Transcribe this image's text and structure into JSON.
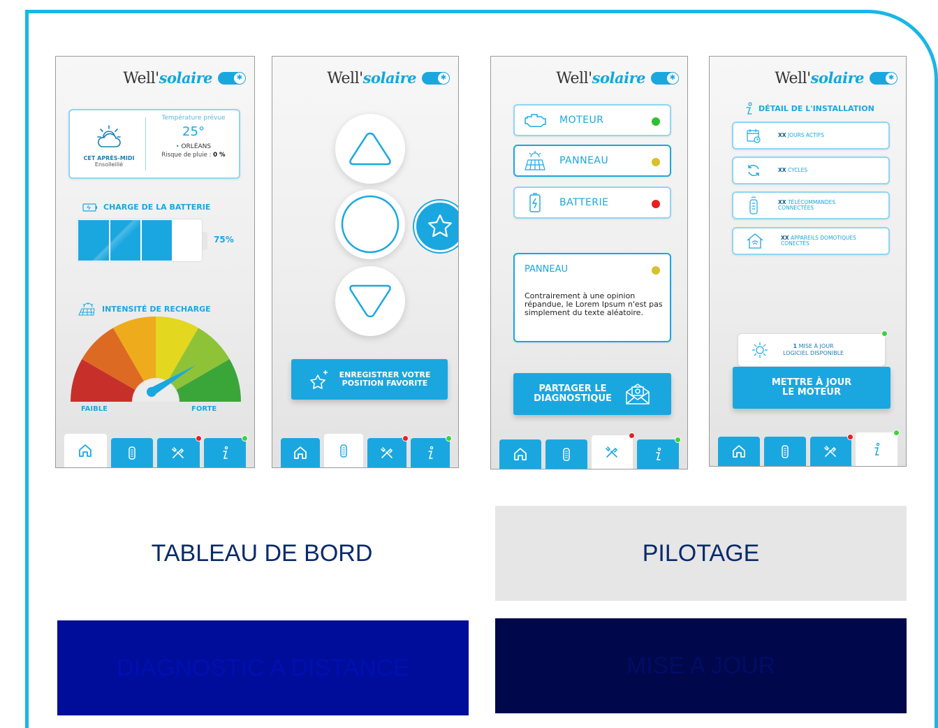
{
  "brand": {
    "name_plain": "Well'",
    "name_styled": "solaire",
    "accent": "#1aa7e0"
  },
  "dashboard": {
    "weather": {
      "period": "CET APRÈS-MIDI",
      "condition": "Ensolleillé",
      "temp_label": "Température prévue",
      "temp": "25°",
      "city": "ORLÉANS",
      "rain_label": "Risque de pluie :",
      "rain_value": "0 %"
    },
    "battery_title": "CHARGE DE LA BATTERIE",
    "battery_level": 0.75,
    "battery_pct": "75%",
    "intensity_title": "INTENSITÉ DE RECHARGE",
    "gauge_low": "FAIBLE",
    "gauge_high": "FORTE",
    "gauge_colors": [
      "#c7302a",
      "#dd6a23",
      "#eeab1c",
      "#e3d71f",
      "#8ec338",
      "#3aa63a"
    ]
  },
  "pilotage": {
    "favorite_label": "ENREGISTRER VOTRE\nPOSITION FAVORITE"
  },
  "diagnostic": {
    "items": [
      {
        "label": "MOTEUR",
        "status": "#2fc02f",
        "icon": "engine-icon"
      },
      {
        "label": "PANNEAU",
        "status": "#d8c22c",
        "icon": "solar-panel-icon"
      },
      {
        "label": "BATTERIE",
        "status": "#e8201f",
        "icon": "battery-icon"
      }
    ],
    "detail_title": "PANNEAU",
    "detail_status": "#d8c22c",
    "detail_body": "Contrairement à une opinion répandue, le Lorem Ipsum n'est pas simplement du texte aléatoire.",
    "share_label": "PARTAGER LE\nDIAGNOSTIQUE"
  },
  "update": {
    "title": "DÉTAIL DE L'INSTALLATION",
    "rows": [
      {
        "bold": "XX",
        "text": "JOURS ACTIFS",
        "icon": "calendar-icon"
      },
      {
        "bold": "XX",
        "text": "CYCLES",
        "icon": "cycle-icon"
      },
      {
        "bold": "XX",
        "text": "TÉLÉCOMMANDES\nCONNECTÉES",
        "icon": "remote-icon"
      },
      {
        "bold": "XX",
        "text": "APPAREILS DOMOTIQUES\nCONECTÉS",
        "icon": "smart-home-icon"
      }
    ],
    "update_notice_bold": "1",
    "update_notice": "MISE À JOUR\nLOGICIEL DISPONIBLE",
    "update_button": "METTRE À JOUR\nLE MOTEUR"
  },
  "tabbar": {
    "dot_red": "#e8201f",
    "dot_green": "#3dd13d"
  },
  "captions": {
    "dashboard": {
      "text": "TABLEAU DE BORD",
      "bg": "#ffffff",
      "color": "#0a2a6b"
    },
    "pilotage": {
      "text": "PILOTAGE",
      "bg": "#e6e6e6",
      "color": "#0a2a6b"
    },
    "diagnostic": {
      "text": "DIAGNOSTIC A DISTANCE",
      "bg": "#000d9b",
      "color": "#0010b0"
    },
    "update": {
      "text": "MISE A JOUR",
      "bg": "#00074a",
      "color": "#000d66"
    }
  }
}
